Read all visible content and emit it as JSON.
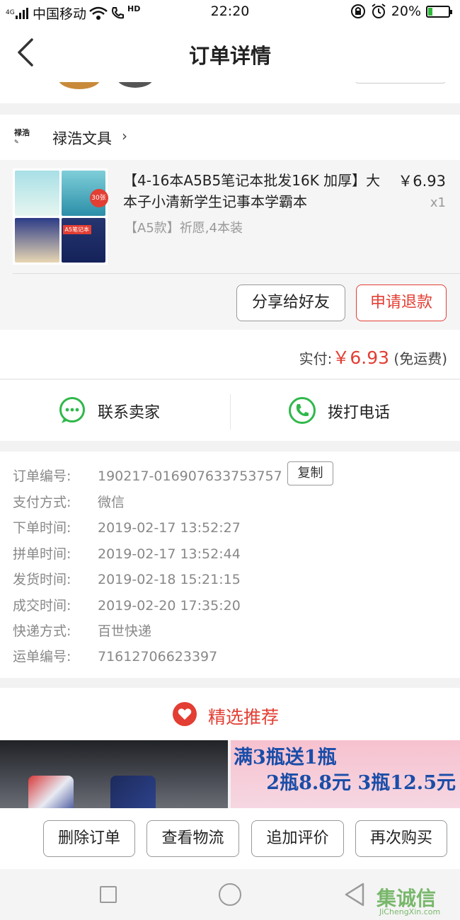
{
  "status_bar": {
    "network": "4G",
    "carrier": "中国移动",
    "hd": "HD",
    "time": "22:20",
    "battery": "20%",
    "battery_level": 0.2
  },
  "nav": {
    "title": "订单详情"
  },
  "shop": {
    "logo_text": "禄浩",
    "name": "禄浩文具"
  },
  "product": {
    "title": "【4-16本A5B5笔记本批发16K 加厚】大本子小清新学生记事本学霸本",
    "spec": "【A5款】祈愿,4本装",
    "price": "￥6.93",
    "qty": "x1",
    "thumb_badge": "30张",
    "thumb_label": "A5笔记本"
  },
  "actions": {
    "share": "分享给好友",
    "refund": "申请退款"
  },
  "payment": {
    "label": "实付:",
    "amount": "￥6.93",
    "shipping": "(免运费)"
  },
  "contact": {
    "seller": "联系卖家",
    "call": "拨打电话"
  },
  "details": {
    "rows": [
      {
        "k": "订单编号:",
        "v": "190217-016907633753757"
      },
      {
        "k": "支付方式:",
        "v": "微信"
      },
      {
        "k": "下单时间:",
        "v": "2019-02-17 13:52:27"
      },
      {
        "k": "拼单时间:",
        "v": "2019-02-17 13:52:44"
      },
      {
        "k": "发货时间:",
        "v": "2019-02-18 15:21:15"
      },
      {
        "k": "成交时间:",
        "v": "2019-02-20 17:35:20"
      },
      {
        "k": "快递方式:",
        "v": "百世快递"
      },
      {
        "k": "运单编号:",
        "v": "71612706623397"
      }
    ],
    "copy": "复制"
  },
  "recommend": {
    "title": "精选推荐",
    "banner2_line1": "满3瓶送1瓶",
    "banner2_line2": "2瓶8.8元 3瓶12.5元"
  },
  "bottom": {
    "delete": "删除订单",
    "logistics": "查看物流",
    "review": "追加评价",
    "rebuy": "再次购买"
  },
  "watermark": {
    "main": "集诚信",
    "sub": "JiChengXin.com"
  },
  "colors": {
    "accent_red": "#e33e33",
    "wechat_green": "#2fb84a"
  }
}
